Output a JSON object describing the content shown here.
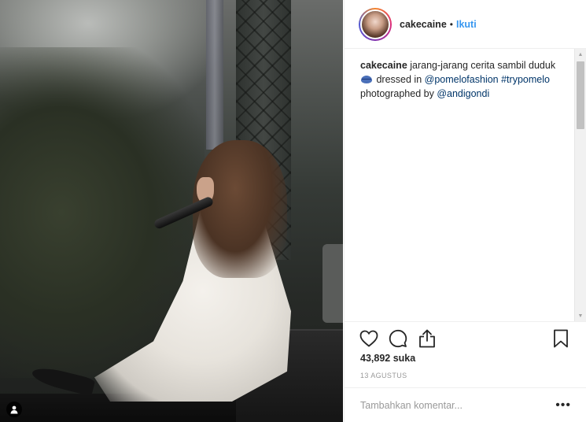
{
  "post": {
    "photo_description_icon": "person-tag-icon"
  },
  "header": {
    "username": "cakecaine",
    "separator": "•",
    "follow_label": "Ikuti"
  },
  "caption": {
    "username": "cakecaine",
    "text_part1": " jarang-jarang cerita sambil duduk",
    "emoji_icon": "lips-emoji-icon",
    "text_part2": " dressed in ",
    "mention1": "@pomelofashion",
    "hashtag": "#trypomelo",
    "text_part3": " photographed by ",
    "mention2": "@andigondi"
  },
  "actions": {
    "like_icon": "heart-icon",
    "comment_icon": "comment-icon",
    "share_icon": "share-icon",
    "save_icon": "bookmark-icon"
  },
  "likes": "43,892 suka",
  "date": "13 AGUSTUS",
  "comment": {
    "placeholder": "Tambahkan komentar...",
    "more": "•••"
  },
  "colors": {
    "link": "#003569",
    "follow": "#3897f0",
    "text": "#262626",
    "muted": "#999999"
  }
}
